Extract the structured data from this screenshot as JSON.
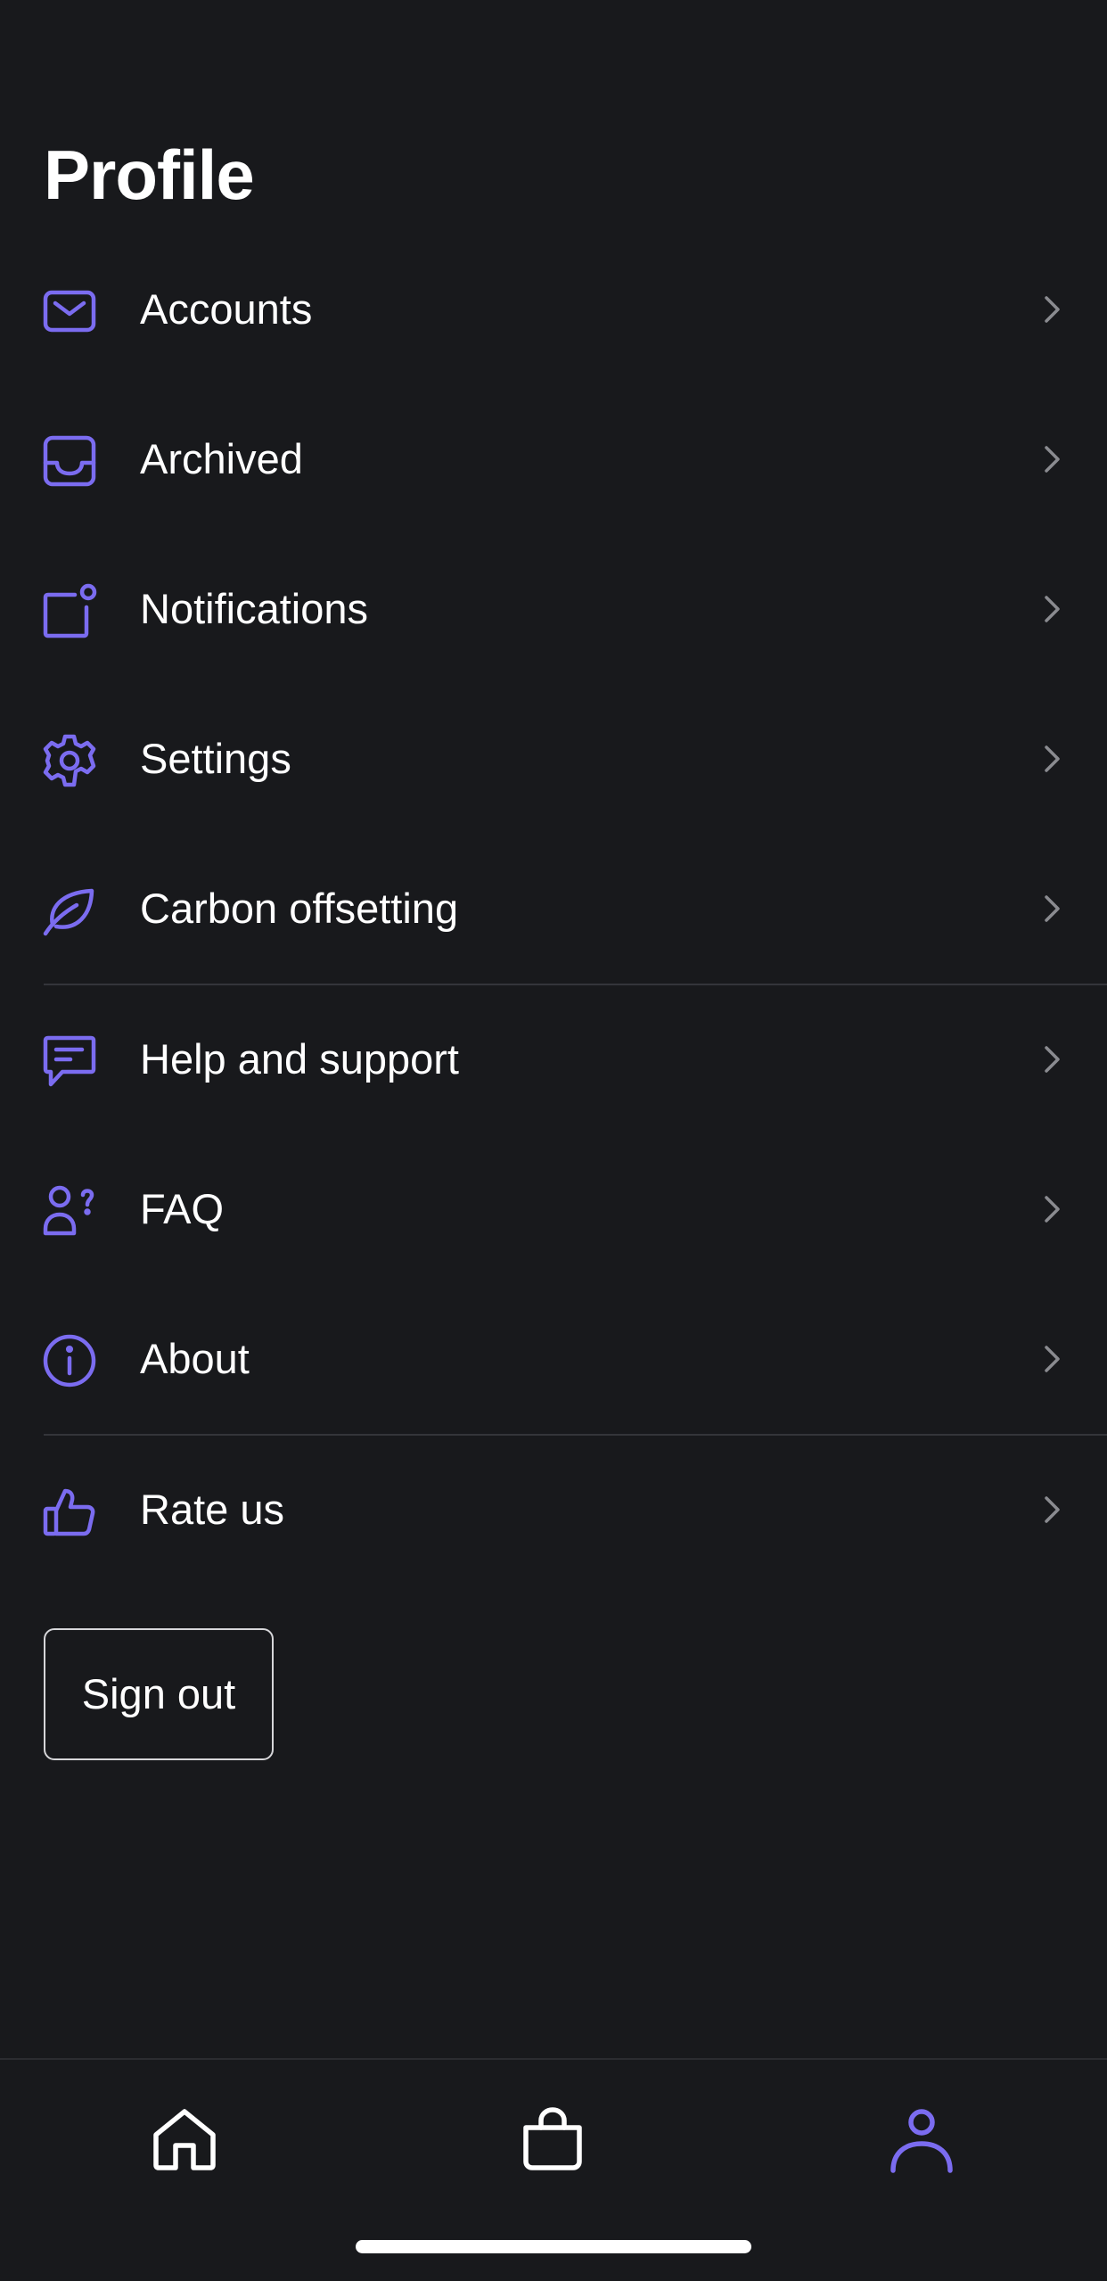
{
  "header": {
    "title": "Profile"
  },
  "colors": {
    "background": "#18191c",
    "accent": "#7b6cf0",
    "chevron": "#8a8b90",
    "divider": "#34353a",
    "text": "#ffffff"
  },
  "menu": {
    "items": [
      {
        "label": "Accounts",
        "icon": "envelope-icon"
      },
      {
        "label": "Archived",
        "icon": "inbox-tray-icon"
      },
      {
        "label": "Notifications",
        "icon": "notification-badge-icon"
      },
      {
        "label": "Settings",
        "icon": "gear-icon"
      },
      {
        "label": "Carbon offsetting",
        "icon": "leaf-icon"
      },
      {
        "label": "Help and support",
        "icon": "chat-bubble-icon"
      },
      {
        "label": "FAQ",
        "icon": "user-question-icon"
      },
      {
        "label": "About",
        "icon": "info-circle-icon"
      },
      {
        "label": "Rate us",
        "icon": "thumbs-up-icon"
      }
    ]
  },
  "actions": {
    "sign_out_label": "Sign out"
  },
  "tabbar": {
    "tabs": [
      {
        "name": "home",
        "icon": "home-icon",
        "active": false
      },
      {
        "name": "shop",
        "icon": "shopping-bag-icon",
        "active": false
      },
      {
        "name": "profile",
        "icon": "profile-person-icon",
        "active": true
      }
    ]
  }
}
